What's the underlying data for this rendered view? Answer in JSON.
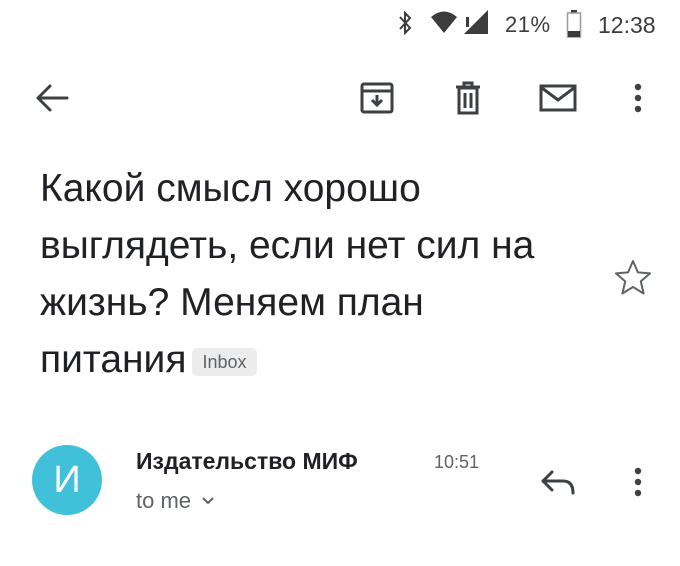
{
  "status_bar": {
    "battery_percent": "21%",
    "time": "12:38",
    "icons": [
      "bluetooth-icon",
      "wifi-icon",
      "signal-icon",
      "battery-icon"
    ]
  },
  "toolbar": {
    "icons": [
      "back-arrow-icon",
      "archive-icon",
      "trash-icon",
      "mark-unread-icon",
      "more-vert-icon"
    ]
  },
  "email": {
    "subject": "Какой смысл хорошо выглядеть, если нет сил на жизнь? Меняем план питания",
    "label": "Inbox",
    "starred": false
  },
  "sender": {
    "avatar_letter": "И",
    "avatar_color": "#40c1d9",
    "name": "Издательство МИФ",
    "time": "10:51",
    "recipient": "to me"
  }
}
